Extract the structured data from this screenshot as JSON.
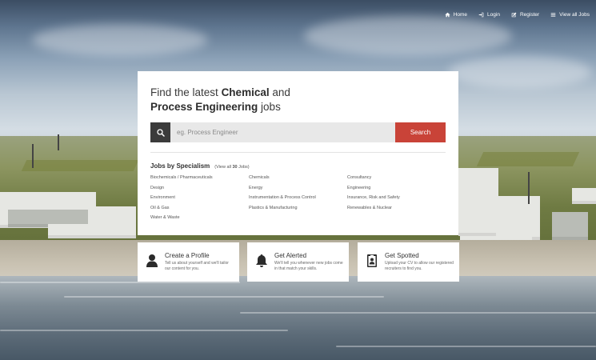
{
  "nav": {
    "items": [
      {
        "label": "Home",
        "icon": "home-icon"
      },
      {
        "label": "Login",
        "icon": "login-icon"
      },
      {
        "label": "Register",
        "icon": "edit-icon"
      },
      {
        "label": "View all Jobs",
        "icon": "list-icon"
      }
    ]
  },
  "hero": {
    "line1_prefix": "Find the latest ",
    "line1_bold": "Chemical",
    "line1_suffix": " and",
    "line2_bold": "Process Engineering",
    "line2_suffix": " jobs"
  },
  "search": {
    "placeholder": "eg. Process Engineer",
    "button_label": "Search"
  },
  "specialism": {
    "title": "Jobs by Specialism",
    "view_all_prefix": "(View all ",
    "view_all_count": "30",
    "view_all_suffix": " Jobs)",
    "items": [
      "Biochemicals / Pharmaceuticals",
      "Chemicals",
      "Consultancy",
      "Design",
      "Energy",
      "Engineering",
      "Environment",
      "Instrumentation & Process Control",
      "Insurance, Risk and Safety",
      "Oil & Gas",
      "Plastics & Manufacturing",
      "Renewables & Nuclear",
      "Water & Waste"
    ]
  },
  "features": [
    {
      "title": "Create a Profile",
      "desc": "Tell us about yourself and we'll tailor our content for you.",
      "icon": "user-icon"
    },
    {
      "title": "Get Alerted",
      "desc": "We'll tell you whenever new jobs come in that match your skills.",
      "icon": "bell-icon"
    },
    {
      "title": "Get Spotted",
      "desc": "Upload your CV to allow our registered recruiters to find you.",
      "icon": "id-badge-icon"
    }
  ],
  "colors": {
    "accent": "#c94338",
    "search_icon_bg": "#3b3b3b",
    "input_bg": "#e8e8e8"
  }
}
